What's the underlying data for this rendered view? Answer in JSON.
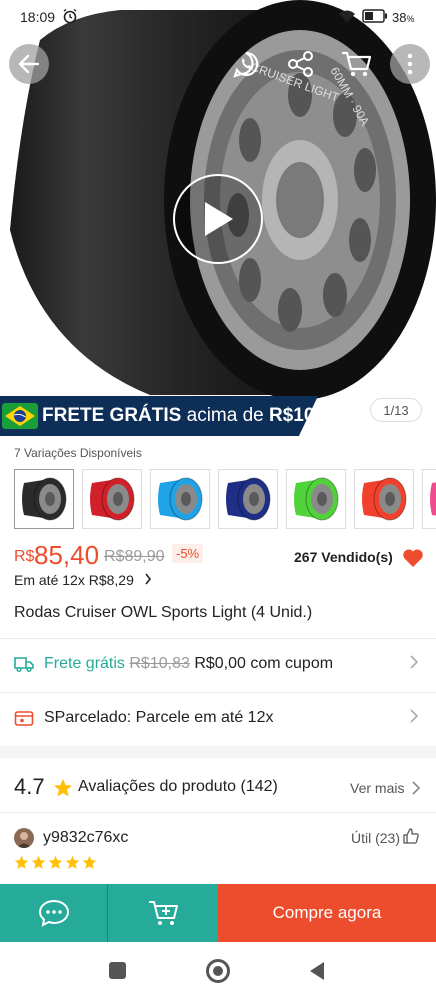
{
  "status_bar": {
    "time": "18:09",
    "battery_percent": "38",
    "battery_suffix": "%"
  },
  "gallery": {
    "counter": "1/13",
    "wheel_text_1": "CRUISER LIGHT",
    "wheel_text_2": "60MM · 90A",
    "banner_text": "FRETE GRÁTIS",
    "banner_suffix": " acima de ",
    "banner_amount": "R$10"
  },
  "variations": {
    "label": "7 Variações Disponíveis",
    "colors": [
      "#2b2b2b",
      "#d0202a",
      "#1fa2e6",
      "#1e2f85",
      "#4fd23a",
      "#f1402c",
      "#f04b8f"
    ]
  },
  "price": {
    "currency": "R$",
    "current": "85,40",
    "original": "R$89,90",
    "discount": "-5%",
    "sold": "267 Vendido(s)",
    "installments_prefix": "Em até ",
    "installments_value": "12x R$8,29"
  },
  "product": {
    "title": "Rodas Cruiser OWL Sports Light (4 Unid.)"
  },
  "shipping": {
    "label": "Frete grátis",
    "old_price": "R$10,83",
    "new_price": " R$0,00 com cupom"
  },
  "parcelado": {
    "label": "SParcelado: Parcele em até 12x"
  },
  "ratings": {
    "score": "4.7",
    "label": "Avaliações do produto",
    "count": "(142)",
    "see_more": "Ver mais"
  },
  "review": {
    "username": "y9832c76xc",
    "helpful": "Útil (23)",
    "stars": 5
  },
  "bottom_bar": {
    "buy_label": "Compre agora"
  },
  "colors": {
    "accent": "#ee4d2d",
    "teal": "#26aa99",
    "banner_navy": "#0d2e57",
    "star": "#ffc107"
  }
}
